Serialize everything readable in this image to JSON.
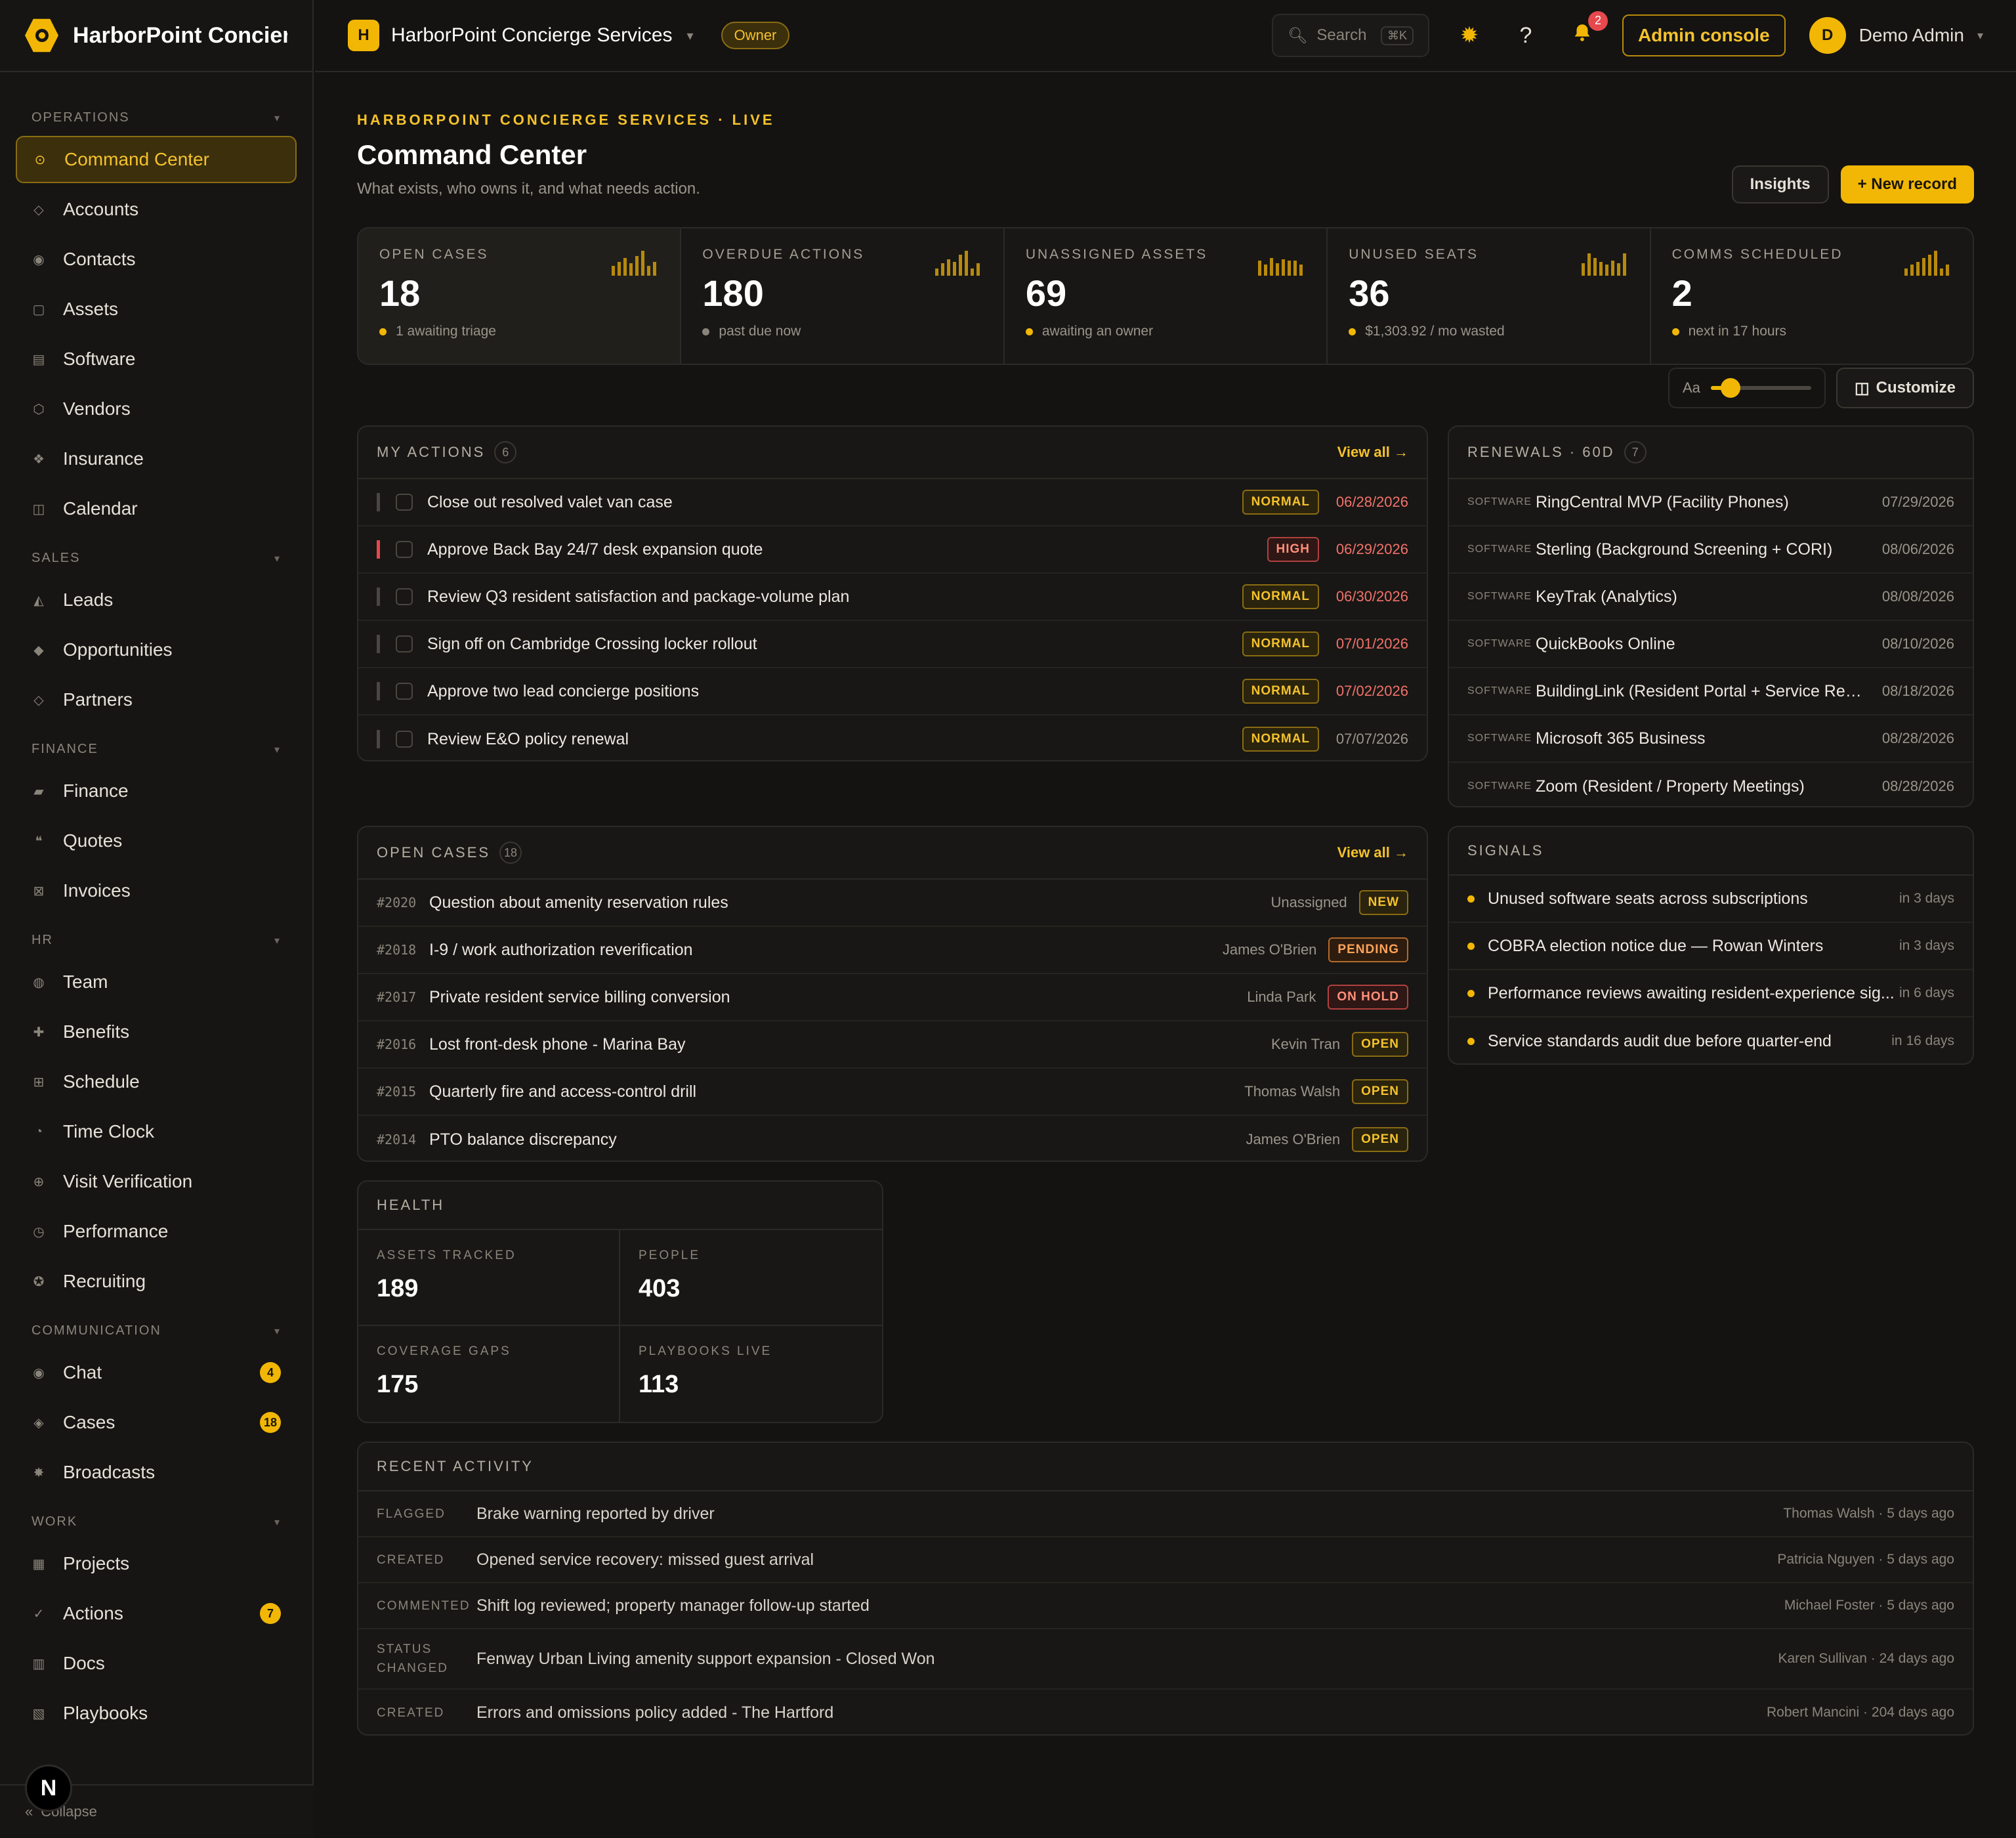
{
  "app": {
    "name": "HarborPoint Concier...",
    "collapse": "Collapse",
    "n_badge": "N"
  },
  "topbar": {
    "org_initial": "H",
    "org_name": "HarborPoint Concierge Services",
    "role": "Owner",
    "search_placeholder": "Search",
    "search_kbd": "⌘K",
    "notif_count": "2",
    "admin_label": "Admin console",
    "user_initial": "D",
    "user_name": "Demo Admin"
  },
  "sidebar": {
    "sections": [
      {
        "title": "OPERATIONS",
        "items": [
          {
            "label": "Command Center",
            "icon": "target-icon",
            "glyph": "⊙",
            "active": true
          },
          {
            "label": "Accounts",
            "icon": "diamond-icon",
            "glyph": "◇"
          },
          {
            "label": "Contacts",
            "icon": "person-icon",
            "glyph": "◉"
          },
          {
            "label": "Assets",
            "icon": "box-icon",
            "glyph": "▢"
          },
          {
            "label": "Software",
            "icon": "stack-icon",
            "glyph": "▤"
          },
          {
            "label": "Vendors",
            "icon": "hexagon-icon",
            "glyph": "⬡"
          },
          {
            "label": "Insurance",
            "icon": "shield-icon",
            "glyph": "❖"
          },
          {
            "label": "Calendar",
            "icon": "calendar-icon",
            "glyph": "◫"
          }
        ]
      },
      {
        "title": "SALES",
        "items": [
          {
            "label": "Leads",
            "icon": "funnel-icon",
            "glyph": "◭"
          },
          {
            "label": "Opportunities",
            "icon": "gem-icon",
            "glyph": "◆"
          },
          {
            "label": "Partners",
            "icon": "handshake-icon",
            "glyph": "◇"
          }
        ]
      },
      {
        "title": "FINANCE",
        "items": [
          {
            "label": "Finance",
            "icon": "wallet-icon",
            "glyph": "▰"
          },
          {
            "label": "Quotes",
            "icon": "quote-icon",
            "glyph": "❝"
          },
          {
            "label": "Invoices",
            "icon": "invoice-icon",
            "glyph": "⊠"
          }
        ]
      },
      {
        "title": "HR",
        "items": [
          {
            "label": "Team",
            "icon": "team-icon",
            "glyph": "◍"
          },
          {
            "label": "Benefits",
            "icon": "plus-icon",
            "glyph": "✚"
          },
          {
            "label": "Schedule",
            "icon": "grid-icon",
            "glyph": "⊞"
          },
          {
            "label": "Time Clock",
            "icon": "clock-icon",
            "glyph": "◔"
          },
          {
            "label": "Visit Verification",
            "icon": "globe-icon",
            "glyph": "⊕"
          },
          {
            "label": "Performance",
            "icon": "gauge-icon",
            "glyph": "◷"
          },
          {
            "label": "Recruiting",
            "icon": "badge-icon",
            "glyph": "✪"
          }
        ]
      },
      {
        "title": "COMMUNICATION",
        "items": [
          {
            "label": "Chat",
            "icon": "chat-icon",
            "glyph": "◉",
            "badge": "4"
          },
          {
            "label": "Cases",
            "icon": "case-icon",
            "glyph": "◈",
            "badge": "18"
          },
          {
            "label": "Broadcasts",
            "icon": "broadcast-icon",
            "glyph": "✸"
          }
        ]
      },
      {
        "title": "WORK",
        "items": [
          {
            "label": "Projects",
            "icon": "project-icon",
            "glyph": "▦"
          },
          {
            "label": "Actions",
            "icon": "check-icon",
            "glyph": "✓",
            "badge": "7"
          },
          {
            "label": "Docs",
            "icon": "doc-icon",
            "glyph": "▥"
          },
          {
            "label": "Playbooks",
            "icon": "book-icon",
            "glyph": "▧"
          }
        ]
      }
    ]
  },
  "header": {
    "eyebrow": "HARBORPOINT CONCIERGE SERVICES · LIVE",
    "title": "Command Center",
    "subtitle": "What exists, who owns it, and what needs action.",
    "insights_label": "Insights",
    "new_record_label": "+ New record"
  },
  "kpis": [
    {
      "label": "OPEN CASES",
      "value": "18",
      "sub": "1 awaiting triage",
      "dot": "#f2b705",
      "spark": [
        0.4,
        0.55,
        0.7,
        0.5,
        0.8,
        1.0
      ]
    },
    {
      "label": "OVERDUE ACTIONS",
      "value": "180",
      "sub": "past due now",
      "dot": "#8a857b",
      "spark": [
        0.3,
        0.5,
        0.65,
        0.55,
        0.85,
        1.0
      ]
    },
    {
      "label": "UNASSIGNED ASSETS",
      "value": "69",
      "sub": "awaiting an owner",
      "dot": "#f2b705",
      "spark": [
        0.6,
        0.45,
        0.7,
        0.5,
        0.65,
        0.6
      ]
    },
    {
      "label": "UNUSED SEATS",
      "value": "36",
      "sub": "$1,303.92 / mo wasted",
      "dot": "#f2b705",
      "spark": [
        0.5,
        0.9,
        0.7,
        0.55,
        0.45,
        0.6
      ]
    },
    {
      "label": "COMMS SCHEDULED",
      "value": "2",
      "sub": "next in 17 hours",
      "dot": "#f2b705",
      "spark": [
        0.3,
        0.45,
        0.55,
        0.7,
        0.85,
        1.0
      ]
    }
  ],
  "tools": {
    "text_size_label": "Aa",
    "text_size_level": 0.2,
    "customize_label": "Customize"
  },
  "my_actions": {
    "title": "MY ACTIONS",
    "count": "6",
    "view_all": "View all →",
    "rows": [
      {
        "title": "Close out resolved valet van case",
        "priority": "NORMAL",
        "date": "06/28/2026",
        "overdue": true
      },
      {
        "title": "Approve Back Bay 24/7 desk expansion quote",
        "priority": "HIGH",
        "date": "06/29/2026",
        "overdue": true
      },
      {
        "title": "Review Q3 resident satisfaction and package-volume plan",
        "priority": "NORMAL",
        "date": "06/30/2026",
        "overdue": true
      },
      {
        "title": "Sign off on Cambridge Crossing locker rollout",
        "priority": "NORMAL",
        "date": "07/01/2026",
        "overdue": true
      },
      {
        "title": "Approve two lead concierge positions",
        "priority": "NORMAL",
        "date": "07/02/2026",
        "overdue": true
      },
      {
        "title": "Review E&O policy renewal",
        "priority": "NORMAL",
        "date": "07/07/2026",
        "overdue": false
      }
    ]
  },
  "renewals": {
    "title": "RENEWALS · 60D",
    "count": "7",
    "rows": [
      {
        "tag": "SOFTWARE",
        "name": "RingCentral MVP (Facility Phones)",
        "date": "07/29/2026"
      },
      {
        "tag": "SOFTWARE",
        "name": "Sterling (Background Screening + CORI)",
        "date": "08/06/2026"
      },
      {
        "tag": "SOFTWARE",
        "name": "KeyTrak (Analytics)",
        "date": "08/08/2026"
      },
      {
        "tag": "SOFTWARE",
        "name": "QuickBooks Online",
        "date": "08/10/2026"
      },
      {
        "tag": "SOFTWARE",
        "name": "BuildingLink (Resident Portal + Service Requ...",
        "date": "08/18/2026"
      },
      {
        "tag": "SOFTWARE",
        "name": "Microsoft 365 Business",
        "date": "08/28/2026"
      },
      {
        "tag": "SOFTWARE",
        "name": "Zoom (Resident / Property Meetings)",
        "date": "08/28/2026"
      }
    ]
  },
  "open_cases": {
    "title": "OPEN CASES",
    "count": "18",
    "view_all": "View all →",
    "rows": [
      {
        "id": "#2020",
        "title": "Question about amenity reservation rules",
        "assignee": "Unassigned",
        "status": "NEW",
        "kind": "new"
      },
      {
        "id": "#2018",
        "title": "I-9 / work authorization reverification",
        "assignee": "James O'Brien",
        "status": "PENDING",
        "kind": "pending"
      },
      {
        "id": "#2017",
        "title": "Private resident service billing conversion",
        "assignee": "Linda Park",
        "status": "ON HOLD",
        "kind": "hold"
      },
      {
        "id": "#2016",
        "title": "Lost front-desk phone - Marina Bay",
        "assignee": "Kevin Tran",
        "status": "OPEN",
        "kind": "open"
      },
      {
        "id": "#2015",
        "title": "Quarterly fire and access-control drill",
        "assignee": "Thomas Walsh",
        "status": "OPEN",
        "kind": "open"
      },
      {
        "id": "#2014",
        "title": "PTO balance discrepancy",
        "assignee": "James O'Brien",
        "status": "OPEN",
        "kind": "open"
      }
    ]
  },
  "signals": {
    "title": "SIGNALS",
    "rows": [
      {
        "text": "Unused software seats across subscriptions",
        "when": "in 3 days"
      },
      {
        "text": "COBRA election notice due — Rowan Winters",
        "when": "in 3 days"
      },
      {
        "text": "Performance reviews awaiting resident-experience sig...",
        "when": "in 6 days"
      },
      {
        "text": "Service standards audit due before quarter-end",
        "when": "in 16 days"
      }
    ]
  },
  "health": {
    "title": "HEALTH",
    "cells": [
      {
        "label": "ASSETS TRACKED",
        "value": "189"
      },
      {
        "label": "PEOPLE",
        "value": "403"
      },
      {
        "label": "COVERAGE GAPS",
        "value": "175"
      },
      {
        "label": "PLAYBOOKS LIVE",
        "value": "113"
      }
    ]
  },
  "activity": {
    "title": "RECENT ACTIVITY",
    "rows": [
      {
        "type": "FLAGGED",
        "text": "Brake warning reported by driver",
        "meta": "Thomas Walsh · 5 days ago"
      },
      {
        "type": "CREATED",
        "text": "Opened service recovery: missed guest arrival",
        "meta": "Patricia Nguyen · 5 days ago"
      },
      {
        "type": "COMMENTED",
        "text": "Shift log reviewed; property manager follow-up started",
        "meta": "Michael Foster · 5 days ago"
      },
      {
        "type": "STATUS CHANGED",
        "text": "Fenway Urban Living amenity support expansion - Closed Won",
        "meta": "Karen Sullivan · 24 days ago"
      },
      {
        "type": "CREATED",
        "text": "Errors and omissions policy added - The Hartford",
        "meta": "Robert Mancini · 204 days ago"
      }
    ]
  }
}
